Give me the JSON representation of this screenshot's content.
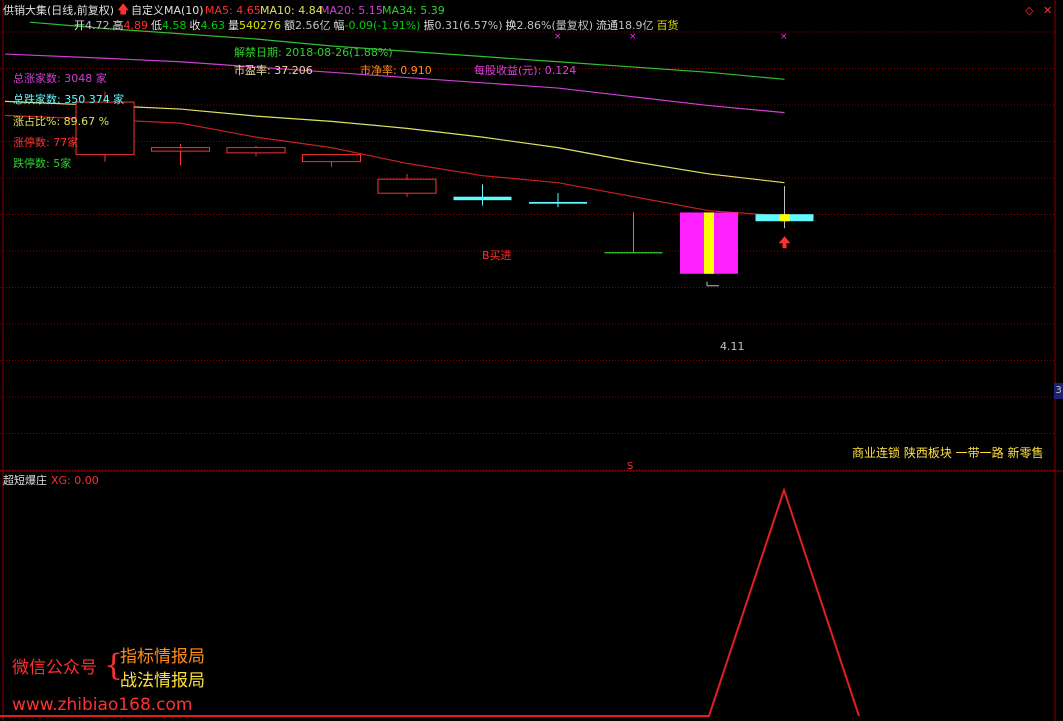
{
  "header": {
    "title": "供销大集(日线,前复权)",
    "indicator_name": "自定义MA(10)",
    "ma5_label": "MA5: 4.65",
    "ma10_label": "MA10: 4.84",
    "ma20_label": "MA20: 5.15",
    "ma34_label": "MA34: 5.39",
    "quote": [
      {
        "label": "开",
        "value": "4.72",
        "color": "#c0c0c0"
      },
      {
        "label": "高",
        "value": "4.89",
        "color": "#ff3030"
      },
      {
        "label": "低",
        "value": "4.58",
        "color": "#00d000"
      },
      {
        "label": "收",
        "value": "4.63",
        "color": "#00d000"
      },
      {
        "label": "量",
        "value": "540276",
        "color": "#e0e000"
      },
      {
        "label": "额",
        "value": "2.56亿",
        "color": "#c0c0c0"
      },
      {
        "label": "幅",
        "value": "-0.09(-1.91%)",
        "color": "#00d000"
      },
      {
        "label": "振",
        "value": "0.31(6.57%)",
        "color": "#c0c0c0"
      },
      {
        "label": "换",
        "value": "2.86%(量复权)",
        "color": "#c0c0c0"
      },
      {
        "label": "流通",
        "value": "18.9亿",
        "color": "#c0c0c0"
      },
      {
        "label": "",
        "value": "百货",
        "color": "#e0e000"
      }
    ]
  },
  "info": {
    "unlock_date": "解禁日期:   2018-08-26(1.88%)",
    "pe": "市盈率:  37.206",
    "pb": "市净率:  0.910",
    "eps": "每股收益(元):  0.124",
    "total_up": "总涨家数:  3048 家",
    "total_down": "总跌家数:  350 374 家",
    "up_ratio": "涨占比%:  89.67 %",
    "limit_up": "涨停数:  77家",
    "limit_down": "跌停数:  5家"
  },
  "annotations": {
    "buy_signal": "B买进",
    "low_price": "4.11",
    "sector_tags": "商业连锁 陕西板块 一带一路 新零售",
    "marker_s": "S",
    "edge_tag": "3"
  },
  "sub_panel": {
    "title": "超短爆庄",
    "xg_label": "XG: 0.00"
  },
  "watermark": {
    "wechat_label": "微信公众号",
    "brand_1": "指标情报局",
    "brand_2": "战法情报局",
    "url": "www.zhibiao168.com"
  },
  "colors": {
    "background": "#000000",
    "grid": "#8b0000",
    "up": "#ff3030",
    "down": "#5ffbff",
    "ma5": "#c0c0c0",
    "ma10": "#c82020",
    "ma20": "#e0e060",
    "ma34": "#d040d0",
    "ma_long": "#30c030",
    "highlight_magenta": "#ff20ff",
    "highlight_yellow": "#ffff00",
    "xg_line": "#e02020",
    "brand_orange": "#ff8c1a",
    "brand_yellow": "#ffe040"
  },
  "chart_data": {
    "type": "candlestick",
    "price_range": [
      3.2,
      5.7
    ],
    "candles": [
      {
        "open": 5.0,
        "high": 5.36,
        "low": 4.96,
        "close": 5.3
      },
      {
        "open": 5.02,
        "high": 5.06,
        "low": 4.94,
        "close": 5.04
      },
      {
        "open": 5.01,
        "high": 5.05,
        "low": 4.99,
        "close": 5.04
      },
      {
        "open": 4.96,
        "high": 5.0,
        "low": 4.93,
        "close": 5.0
      },
      {
        "open": 4.78,
        "high": 4.89,
        "low": 4.76,
        "close": 4.86
      },
      {
        "open": 4.76,
        "high": 4.83,
        "low": 4.71,
        "close": 4.74
      },
      {
        "open": 4.73,
        "high": 4.78,
        "low": 4.7,
        "close": 4.72
      },
      {
        "open": 4.47,
        "high": 4.47,
        "low": 4.44,
        "close": 4.45
      },
      {
        "open": 4.67,
        "high": 4.67,
        "low": 4.32,
        "close": 4.32
      },
      {
        "open": 4.66,
        "high": 4.82,
        "low": 4.58,
        "close": 4.62
      }
    ],
    "highlight_bars": [
      8,
      9
    ],
    "ma_lines": [
      {
        "name": "MA10",
        "values": [
          5.2,
          5.18,
          5.1,
          5.04,
          4.95,
          4.88,
          4.84,
          4.76,
          4.68,
          4.65
        ]
      },
      {
        "name": "MA20",
        "values": [
          5.28,
          5.26,
          5.22,
          5.19,
          5.15,
          5.1,
          5.04,
          4.96,
          4.89,
          4.84
        ]
      },
      {
        "name": "MA34",
        "values": [
          5.55,
          5.53,
          5.5,
          5.47,
          5.44,
          5.41,
          5.38,
          5.33,
          5.28,
          5.24
        ]
      },
      {
        "name": "long",
        "values": [
          5.72,
          5.69,
          5.66,
          5.62,
          5.59,
          5.56,
          5.53,
          5.5,
          5.47,
          5.43
        ]
      }
    ],
    "xg": {
      "range": [
        0,
        1
      ],
      "values": [
        0,
        0,
        0,
        0,
        0,
        0,
        0,
        0,
        0,
        1,
        0
      ]
    }
  }
}
